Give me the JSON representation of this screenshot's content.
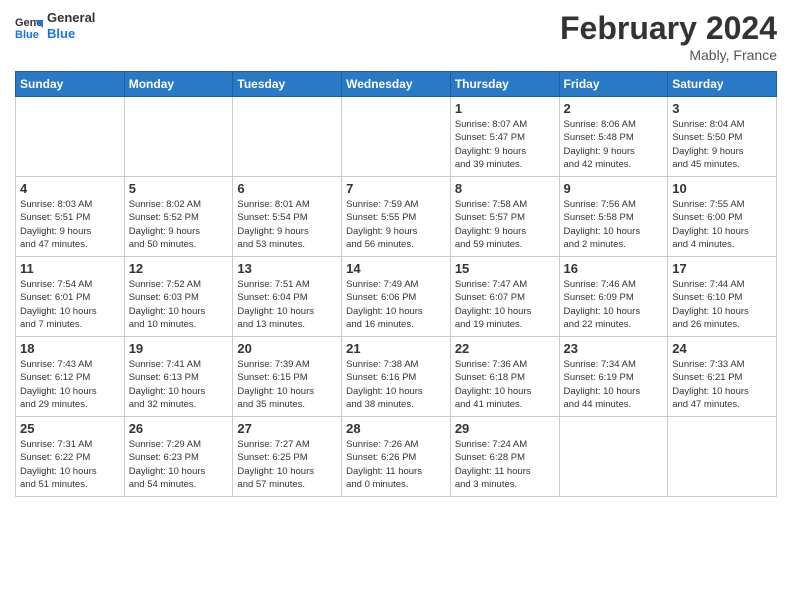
{
  "header": {
    "logo_general": "General",
    "logo_blue": "Blue",
    "month_title": "February 2024",
    "location": "Mably, France"
  },
  "days_of_week": [
    "Sunday",
    "Monday",
    "Tuesday",
    "Wednesday",
    "Thursday",
    "Friday",
    "Saturday"
  ],
  "weeks": [
    [
      {
        "day": "",
        "info": ""
      },
      {
        "day": "",
        "info": ""
      },
      {
        "day": "",
        "info": ""
      },
      {
        "day": "",
        "info": ""
      },
      {
        "day": "1",
        "info": "Sunrise: 8:07 AM\nSunset: 5:47 PM\nDaylight: 9 hours\nand 39 minutes."
      },
      {
        "day": "2",
        "info": "Sunrise: 8:06 AM\nSunset: 5:48 PM\nDaylight: 9 hours\nand 42 minutes."
      },
      {
        "day": "3",
        "info": "Sunrise: 8:04 AM\nSunset: 5:50 PM\nDaylight: 9 hours\nand 45 minutes."
      }
    ],
    [
      {
        "day": "4",
        "info": "Sunrise: 8:03 AM\nSunset: 5:51 PM\nDaylight: 9 hours\nand 47 minutes."
      },
      {
        "day": "5",
        "info": "Sunrise: 8:02 AM\nSunset: 5:52 PM\nDaylight: 9 hours\nand 50 minutes."
      },
      {
        "day": "6",
        "info": "Sunrise: 8:01 AM\nSunset: 5:54 PM\nDaylight: 9 hours\nand 53 minutes."
      },
      {
        "day": "7",
        "info": "Sunrise: 7:59 AM\nSunset: 5:55 PM\nDaylight: 9 hours\nand 56 minutes."
      },
      {
        "day": "8",
        "info": "Sunrise: 7:58 AM\nSunset: 5:57 PM\nDaylight: 9 hours\nand 59 minutes."
      },
      {
        "day": "9",
        "info": "Sunrise: 7:56 AM\nSunset: 5:58 PM\nDaylight: 10 hours\nand 2 minutes."
      },
      {
        "day": "10",
        "info": "Sunrise: 7:55 AM\nSunset: 6:00 PM\nDaylight: 10 hours\nand 4 minutes."
      }
    ],
    [
      {
        "day": "11",
        "info": "Sunrise: 7:54 AM\nSunset: 6:01 PM\nDaylight: 10 hours\nand 7 minutes."
      },
      {
        "day": "12",
        "info": "Sunrise: 7:52 AM\nSunset: 6:03 PM\nDaylight: 10 hours\nand 10 minutes."
      },
      {
        "day": "13",
        "info": "Sunrise: 7:51 AM\nSunset: 6:04 PM\nDaylight: 10 hours\nand 13 minutes."
      },
      {
        "day": "14",
        "info": "Sunrise: 7:49 AM\nSunset: 6:06 PM\nDaylight: 10 hours\nand 16 minutes."
      },
      {
        "day": "15",
        "info": "Sunrise: 7:47 AM\nSunset: 6:07 PM\nDaylight: 10 hours\nand 19 minutes."
      },
      {
        "day": "16",
        "info": "Sunrise: 7:46 AM\nSunset: 6:09 PM\nDaylight: 10 hours\nand 22 minutes."
      },
      {
        "day": "17",
        "info": "Sunrise: 7:44 AM\nSunset: 6:10 PM\nDaylight: 10 hours\nand 26 minutes."
      }
    ],
    [
      {
        "day": "18",
        "info": "Sunrise: 7:43 AM\nSunset: 6:12 PM\nDaylight: 10 hours\nand 29 minutes."
      },
      {
        "day": "19",
        "info": "Sunrise: 7:41 AM\nSunset: 6:13 PM\nDaylight: 10 hours\nand 32 minutes."
      },
      {
        "day": "20",
        "info": "Sunrise: 7:39 AM\nSunset: 6:15 PM\nDaylight: 10 hours\nand 35 minutes."
      },
      {
        "day": "21",
        "info": "Sunrise: 7:38 AM\nSunset: 6:16 PM\nDaylight: 10 hours\nand 38 minutes."
      },
      {
        "day": "22",
        "info": "Sunrise: 7:36 AM\nSunset: 6:18 PM\nDaylight: 10 hours\nand 41 minutes."
      },
      {
        "day": "23",
        "info": "Sunrise: 7:34 AM\nSunset: 6:19 PM\nDaylight: 10 hours\nand 44 minutes."
      },
      {
        "day": "24",
        "info": "Sunrise: 7:33 AM\nSunset: 6:21 PM\nDaylight: 10 hours\nand 47 minutes."
      }
    ],
    [
      {
        "day": "25",
        "info": "Sunrise: 7:31 AM\nSunset: 6:22 PM\nDaylight: 10 hours\nand 51 minutes."
      },
      {
        "day": "26",
        "info": "Sunrise: 7:29 AM\nSunset: 6:23 PM\nDaylight: 10 hours\nand 54 minutes."
      },
      {
        "day": "27",
        "info": "Sunrise: 7:27 AM\nSunset: 6:25 PM\nDaylight: 10 hours\nand 57 minutes."
      },
      {
        "day": "28",
        "info": "Sunrise: 7:26 AM\nSunset: 6:26 PM\nDaylight: 11 hours\nand 0 minutes."
      },
      {
        "day": "29",
        "info": "Sunrise: 7:24 AM\nSunset: 6:28 PM\nDaylight: 11 hours\nand 3 minutes."
      },
      {
        "day": "",
        "info": ""
      },
      {
        "day": "",
        "info": ""
      }
    ]
  ]
}
